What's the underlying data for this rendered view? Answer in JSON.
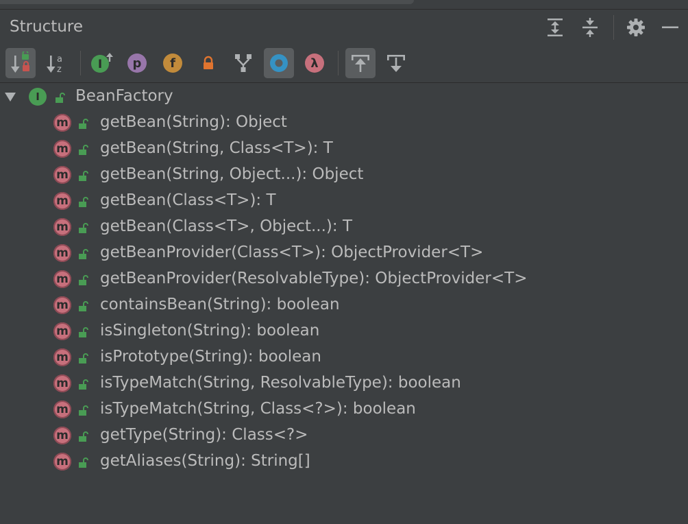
{
  "panel": {
    "title": "Structure"
  },
  "header_buttons": [
    {
      "name": "expand-all-icon"
    },
    {
      "name": "collapse-all-icon"
    },
    {
      "name": "gear-icon"
    },
    {
      "name": "minimize-icon"
    }
  ],
  "toolbar": {
    "buttons": [
      {
        "name": "sort-by-visibility-icon",
        "active": true
      },
      {
        "name": "sort-alphabetically-icon",
        "active": false
      },
      {
        "name": "show-inherited-icon",
        "glyph": "I",
        "color": "#499c54",
        "active": false
      },
      {
        "name": "show-properties-icon",
        "glyph": "p",
        "color": "#9876aa",
        "active": false
      },
      {
        "name": "show-fields-icon",
        "glyph": "f",
        "color": "#c28b3b",
        "active": false
      },
      {
        "name": "show-non-public-icon",
        "active": false
      },
      {
        "name": "group-methods-icon",
        "active": false
      },
      {
        "name": "show-anonymous-icon",
        "color": "#3592c4",
        "active": true
      },
      {
        "name": "show-lambdas-icon",
        "glyph": "λ",
        "color": "#c7707c",
        "active": false
      },
      {
        "name": "autoscroll-to-source-icon",
        "active": true
      },
      {
        "name": "autoscroll-from-source-icon",
        "active": false
      }
    ]
  },
  "tree": {
    "root": {
      "label": "BeanFactory",
      "icon": "interface-icon",
      "icon_glyph": "I",
      "icon_color": "#499c54",
      "expanded": true
    },
    "method_icon_glyph": "m",
    "method_icon_color": "#c7707c",
    "lock_color": "#499c54",
    "methods": [
      "getBean(String): Object",
      "getBean(String, Class<T>): T",
      "getBean(String, Object...): Object",
      "getBean(Class<T>): T",
      "getBean(Class<T>, Object...): T",
      "getBeanProvider(Class<T>): ObjectProvider<T>",
      "getBeanProvider(ResolvableType): ObjectProvider<T>",
      "containsBean(String): boolean",
      "isSingleton(String): boolean",
      "isPrototype(String): boolean",
      "isTypeMatch(String, ResolvableType): boolean",
      "isTypeMatch(String, Class<?>): boolean",
      "getType(String): Class<?>",
      "getAliases(String): String[]"
    ]
  }
}
